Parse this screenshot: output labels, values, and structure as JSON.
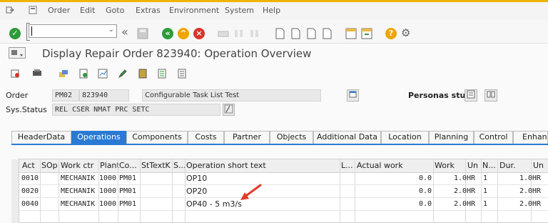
{
  "menubar": {
    "items": [
      "Order",
      "Edit",
      "Goto",
      "Extras",
      "Environment",
      "System",
      "Help"
    ]
  },
  "title": "Display Repair Order 823940: Operation Overview",
  "header": {
    "order_label": "Order",
    "order_type": "PM02",
    "order_number": "823940",
    "order_desc": "Configurable Task List Test",
    "status_label": "Sys.Status",
    "status_value": "REL  CSER NMAT PRC  SETC",
    "personas_label": "Personas stuff"
  },
  "tabs": [
    "HeaderData",
    "Operations",
    "Components",
    "Costs",
    "Partner",
    "Objects",
    "Additional Data",
    "Location",
    "Planning",
    "Control",
    "Enhan"
  ],
  "active_tab": "Operations",
  "table": {
    "columns": [
      "Act",
      "SOp",
      "Work ctr",
      "Plant",
      "Co...",
      "StTextK",
      "S...",
      "Operation short text",
      "L...",
      "Actual work",
      "Work",
      "Un",
      "N...",
      "Dur.",
      "Un"
    ],
    "rows": [
      {
        "act": "0010",
        "work_ctr": "MECHANIK",
        "plant": "1000",
        "co": "PM01",
        "text": "OP10",
        "actual": "0.0",
        "work": "1.0",
        "un": "HR",
        "n": "1",
        "dur": "1.0",
        "un2": "HR"
      },
      {
        "act": "0020",
        "work_ctr": "MECHANIK",
        "plant": "1000",
        "co": "PM01",
        "text": "OP20",
        "actual": "0.0",
        "work": "2.0",
        "un": "HR",
        "n": "1",
        "dur": "2.0",
        "un2": "HR"
      },
      {
        "act": "0040",
        "work_ctr": "MECHANIK",
        "plant": "1000",
        "co": "PM01",
        "text": "OP40 - 5 m3/s",
        "actual": "0.0",
        "work": "2.0",
        "un": "HR",
        "n": "1",
        "dur": "2.0",
        "un2": "HR"
      }
    ]
  },
  "colors": {
    "accent": "#2a7ad3",
    "sap_yellow": "#f0b400",
    "ok_green": "#2e9b3a",
    "arrow_red": "#e03c2b"
  }
}
